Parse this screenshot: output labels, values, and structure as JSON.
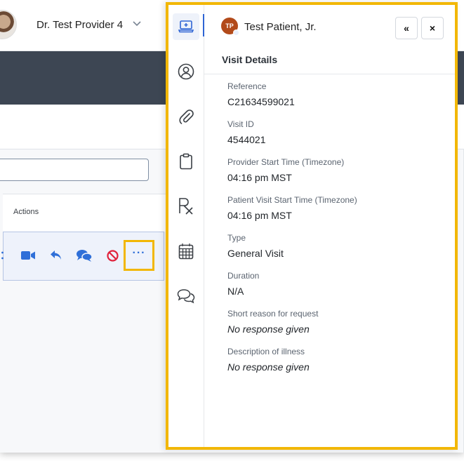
{
  "app": {
    "provider_name": "Dr. Test Provider 4",
    "actions_header": "Actions",
    "search_value": "",
    "row_actions": [
      {
        "icon": "video-icon",
        "label": "Start video"
      },
      {
        "icon": "reply-icon",
        "label": "Reply"
      },
      {
        "icon": "chat-icon",
        "label": "Chat"
      },
      {
        "icon": "block-icon",
        "label": "Cancel"
      },
      {
        "icon": "more-icon",
        "label": "More"
      }
    ],
    "more_glyph": "···"
  },
  "panel": {
    "patient_initials": "TP",
    "patient_name": "Test Patient, Jr.",
    "collapse_glyph": "«",
    "close_glyph": "×",
    "section_title": "Visit Details",
    "rail": [
      {
        "icon": "laptop-medical-icon",
        "active": true
      },
      {
        "icon": "user-circle-icon",
        "active": false
      },
      {
        "icon": "paperclip-icon",
        "active": false
      },
      {
        "icon": "clipboard-icon",
        "active": false
      },
      {
        "icon": "prescription-icon",
        "active": false
      },
      {
        "icon": "calendar-icon",
        "active": false
      },
      {
        "icon": "conversation-icon",
        "active": false
      }
    ],
    "fields": [
      {
        "label": "Reference",
        "value": "C21634599021",
        "italic": false
      },
      {
        "label": "Visit ID",
        "value": "4544021",
        "italic": false
      },
      {
        "label": "Provider Start Time (Timezone)",
        "value": "04:16 pm MST",
        "italic": false
      },
      {
        "label": "Patient Visit Start Time (Timezone)",
        "value": "04:16 pm MST",
        "italic": false
      },
      {
        "label": "Type",
        "value": "General Visit",
        "italic": false
      },
      {
        "label": "Duration",
        "value": "N/A",
        "italic": false
      },
      {
        "label": "Short reason for request",
        "value": "No response given",
        "italic": true
      },
      {
        "label": "Description of illness",
        "value": "No response given",
        "italic": true
      }
    ]
  },
  "colors": {
    "highlight": "#f2b705",
    "accent_blue": "#2f6fd8",
    "dark_band": "#3d4653",
    "patient_avatar": "#b24a1a",
    "danger": "#e0223b"
  }
}
